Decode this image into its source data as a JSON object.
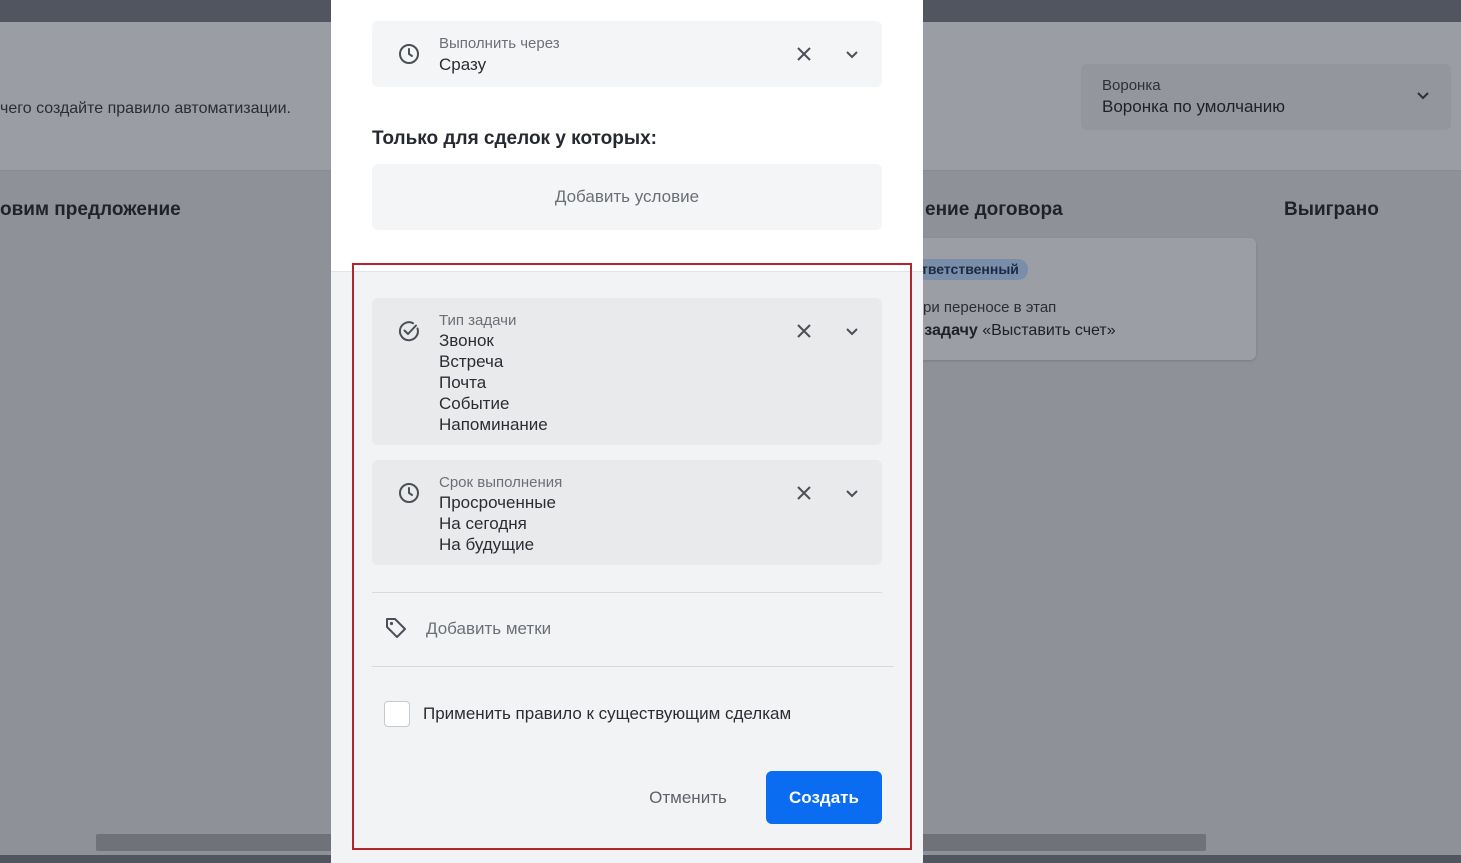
{
  "background": {
    "hint_text": "чего создайте правило автоматизации.",
    "funnel": {
      "label": "Воронка",
      "value": "Воронка по умолчанию",
      "icon": "chevron-down-icon"
    },
    "columns": [
      "овим предложение",
      "ение договора",
      "Выиграно"
    ],
    "card": {
      "badge": "тветственный",
      "line1": "ри переносе в этап",
      "line2_bold": "ь задачу",
      "line2_rest": " «Выставить счет»"
    }
  },
  "modal": {
    "execute_field": {
      "label": "Выполнить через",
      "value": "Сразу",
      "icon": "clock-icon"
    },
    "conditions_title": "Только для сделок у которых:",
    "add_condition": "Добавить условие",
    "task_type_field": {
      "label": "Тип задачи",
      "values": [
        "Звонок",
        "Встреча",
        "Почта",
        "Событие",
        "Напоминание"
      ],
      "icon": "check-circle-icon"
    },
    "deadline_field": {
      "label": "Срок выполнения",
      "values": [
        "Просроченные",
        "На сегодня",
        "На будущие"
      ],
      "icon": "clock-icon"
    },
    "add_tags": "Добавить метки",
    "apply_existing": "Применить правило к существующим сделкам",
    "cancel_label": "Отменить",
    "create_label": "Создать"
  },
  "colors": {
    "primary_button": "#0a6cf0",
    "highlight_border": "#b3262c",
    "overlay": "#8e9198"
  }
}
